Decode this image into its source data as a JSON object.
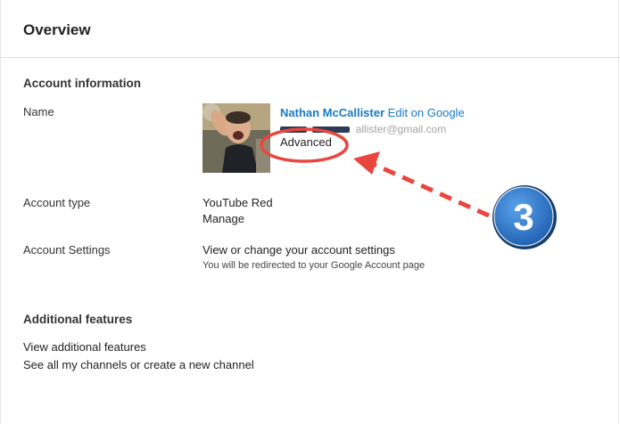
{
  "overview": {
    "title": "Overview"
  },
  "account_information": {
    "heading": "Account information",
    "name": {
      "label": "Name",
      "user_name": "Nathan McCallister",
      "edit_link": "Edit on Google",
      "email_partial": "allister@gmail.com",
      "advanced_link": "Advanced"
    },
    "account_type": {
      "label": "Account type",
      "value": "YouTube Red",
      "manage_link": "Manage"
    },
    "account_settings": {
      "label": "Account Settings",
      "link": "View or change your account settings",
      "note": "You will be redirected to your Google Account page"
    }
  },
  "additional_features": {
    "heading": "Additional features",
    "view_link": "View additional features",
    "channels_link": "See all my channels or create a new channel"
  },
  "annotation": {
    "step_number": "3",
    "circle_color": "#e8463e",
    "badge_color": "#2e78c9"
  }
}
